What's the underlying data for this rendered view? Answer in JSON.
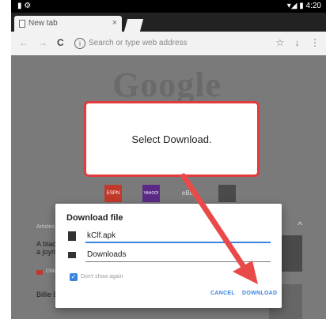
{
  "status_bar": {
    "time": "4:20",
    "left_icons": "▮ ⚙",
    "right_icons": "▾◢ ▮"
  },
  "tab": {
    "title": "New tab",
    "close_glyph": "×"
  },
  "toolbar": {
    "back_glyph": "←",
    "forward_glyph": "→",
    "reload_glyph": "C",
    "omnibox_placeholder": "Search or type web address",
    "info_glyph": "i",
    "star_glyph": "☆",
    "download_glyph": "↓",
    "menu_glyph": "⋮"
  },
  "page": {
    "logo": "Google",
    "tiles": [
      {
        "label": "ESPN",
        "color": "#c1392b"
      },
      {
        "label": "YAHOO!",
        "color": "#5b2a86"
      },
      {
        "label": "eBay",
        "color": "#7a7a7a"
      },
      {
        "label": "",
        "color": "#4a4a4a"
      }
    ],
    "articles_label": "Articles fo",
    "card1_text": "A black\na joyrid",
    "card1_source": "CNN",
    "card2_text": "Billie Ei",
    "caret": "^"
  },
  "callout": {
    "text": "Select Download."
  },
  "dialog": {
    "title": "Download file",
    "filename": "kClf.apk",
    "folder": "Downloads",
    "dont_show_again": "Don't show again",
    "checkbox_checked": true,
    "cancel": "CANCEL",
    "download": "DOWNLOAD"
  },
  "colors": {
    "accent": "#3b83e0",
    "callout_border": "#e23b3b",
    "arrow": "#e84a4a"
  }
}
